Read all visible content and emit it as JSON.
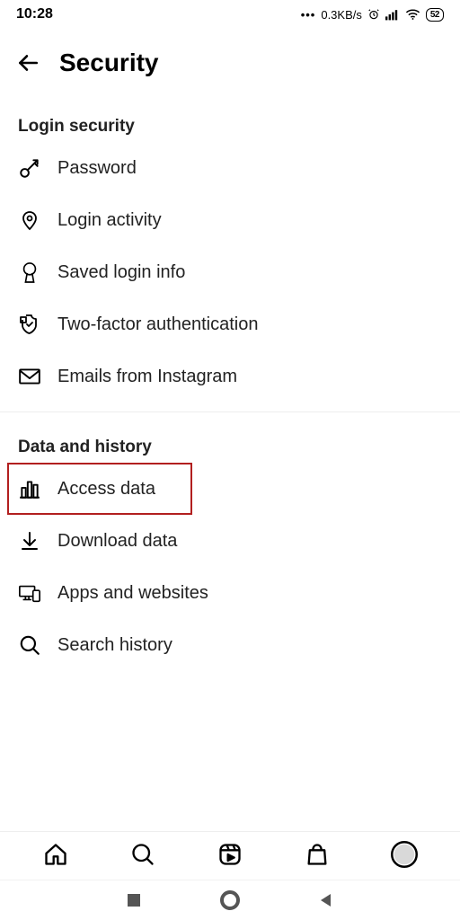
{
  "status": {
    "time": "10:28",
    "net": "0.3KB/s",
    "battery": "52"
  },
  "header": {
    "title": "Security"
  },
  "sections": {
    "login": {
      "title": "Login security",
      "items": {
        "password": "Password",
        "login_activity": "Login activity",
        "saved_login": "Saved login info",
        "two_factor": "Two-factor authentication",
        "emails": "Emails from Instagram"
      }
    },
    "data": {
      "title": "Data and history",
      "items": {
        "access_data": "Access data",
        "download_data": "Download data",
        "apps_websites": "Apps and websites",
        "search_history": "Search history"
      }
    }
  }
}
